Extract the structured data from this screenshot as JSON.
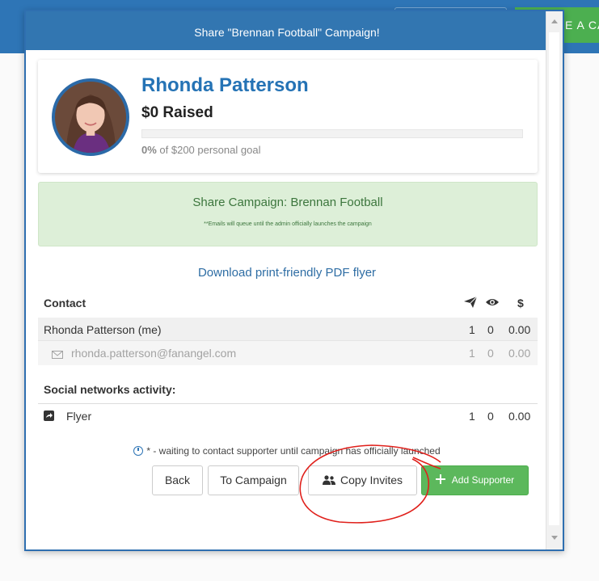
{
  "background": {
    "create_button_label": "E A CA"
  },
  "modal": {
    "title": "Share \"Brennan Football\" Campaign!"
  },
  "profile": {
    "name": "Rhonda Patterson",
    "raised": "$0 Raised",
    "progress_percent": 0,
    "goal_percent": "0%",
    "goal_text": " of $200 personal goal"
  },
  "share": {
    "title": "Share Campaign: Brennan Football",
    "note": "**Emails will queue until the admin officially launches the campaign"
  },
  "download_link": "Download print-friendly PDF flyer",
  "contacts": {
    "header": "Contact",
    "sent_icon": "paper-plane-icon",
    "views_icon": "eye-icon",
    "money_header": "$",
    "rows": [
      {
        "name": "Rhonda Patterson (me)",
        "sent": "1",
        "views": "0",
        "amount": "0.00"
      },
      {
        "name": "rhonda.patterson@fanangel.com",
        "sent": "1",
        "views": "0",
        "amount": "0.00"
      }
    ]
  },
  "social": {
    "title": "Social networks activity:",
    "rows": [
      {
        "name": "Flyer",
        "sent": "1",
        "views": "0",
        "amount": "0.00"
      }
    ]
  },
  "waiting_note": "* - waiting to contact supporter until campaign has officially launched",
  "buttons": {
    "back": "Back",
    "to_campaign": "To Campaign",
    "copy_invites": "Copy Invites",
    "add_supporter": "Add Supporter"
  },
  "colors": {
    "primary": "#3276b1",
    "success": "#5cb85c",
    "share_bg": "#ddefd8",
    "annotation": "#e0201b"
  }
}
